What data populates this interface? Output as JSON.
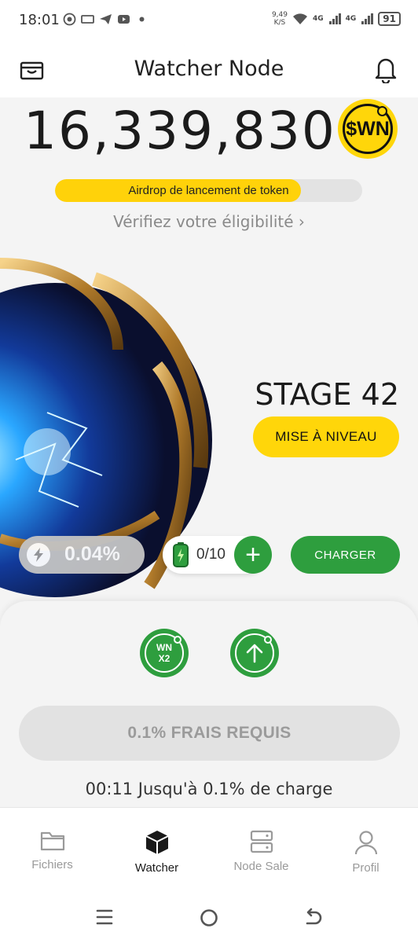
{
  "status_bar": {
    "time": "18:01",
    "net_speed_value": "9,49",
    "net_speed_unit": "K/S",
    "signal_1": "4G",
    "signal_2": "4G",
    "battery": "91"
  },
  "header": {
    "title": "Watcher Node"
  },
  "balance": {
    "amount": "16,339,830",
    "token": "$WN"
  },
  "airdrop": {
    "label": "Airdrop de lancement de token",
    "progress": 0.8,
    "verify_link": "Vérifiez votre éligibilité ›"
  },
  "stage": {
    "title": "STAGE 42",
    "upgrade_label": "MISE À NIVEAU"
  },
  "controls": {
    "rate": "0.04%",
    "battery_count": "0/10",
    "add_label": "+",
    "charge_label": "CHARGER"
  },
  "panel": {
    "boost_label_line1": "WN",
    "boost_label_line2": "X2",
    "fee_label": "0.1% FRAIS REQUIS",
    "timer_text": "00:11 Jusqu'à 0.1% de charge"
  },
  "bottom_nav": {
    "items": [
      {
        "label": "Fichiers",
        "icon": "folder-icon"
      },
      {
        "label": "Watcher",
        "icon": "cube-icon"
      },
      {
        "label": "Node Sale",
        "icon": "server-icon"
      },
      {
        "label": "Profil",
        "icon": "user-icon"
      }
    ],
    "active_index": 1
  },
  "colors": {
    "accent_yellow": "#ffd60a",
    "accent_green": "#2e9e3e"
  }
}
